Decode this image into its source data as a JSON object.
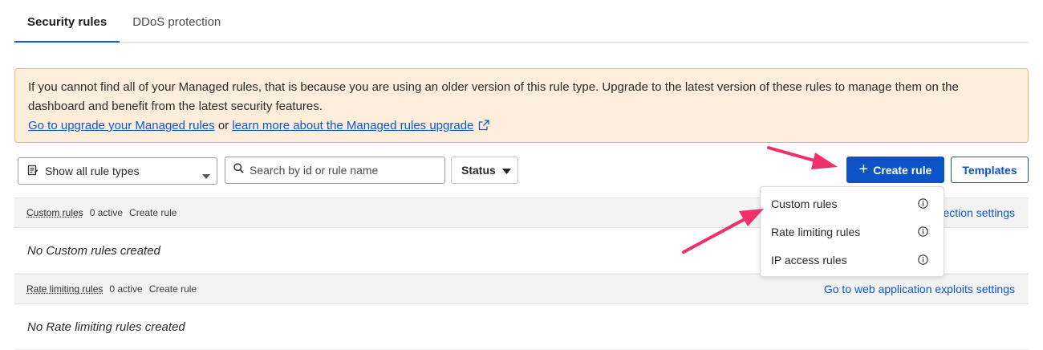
{
  "tabs": [
    {
      "label": "Security rules",
      "active": true
    },
    {
      "label": "DDoS protection",
      "active": false
    }
  ],
  "banner": {
    "message": "If you cannot find all of your Managed rules, that is because you are using an older version of this rule type. Upgrade to the latest version of these rules to manage them on the dashboard and benefit from the latest security features.",
    "link_upgrade": "Go to upgrade your Managed rules",
    "or_text": "or",
    "link_learn": "learn more about the Managed rules upgrade",
    "external_icon": "external-link-icon"
  },
  "toolbar": {
    "rule_type_select": "Show all rule types",
    "search_placeholder": "Search by id or rule name",
    "status_label": "Status",
    "create_label": "Create rule",
    "templates_label": "Templates"
  },
  "sections": [
    {
      "name": "Custom rules",
      "count": "0 active",
      "create": "Create rule",
      "link": "Go to web application protection settings",
      "link_visible": "ection settings",
      "empty": "No Custom rules created"
    },
    {
      "name": "Rate limiting rules",
      "count": "0 active",
      "create": "Create rule",
      "link": "Go to web application exploits settings",
      "empty": "No Rate limiting rules created"
    }
  ],
  "create_menu": {
    "items": [
      {
        "label": "Custom rules",
        "icon": "info-icon"
      },
      {
        "label": "Rate limiting rules",
        "icon": "info-icon"
      },
      {
        "label": "IP access rules",
        "icon": "info-icon"
      }
    ]
  },
  "colors": {
    "accent": "#0b53c7",
    "banner_bg": "#fdeedb",
    "banner_border": "#f0b56e",
    "annotation_arrow": "#f0306a"
  }
}
